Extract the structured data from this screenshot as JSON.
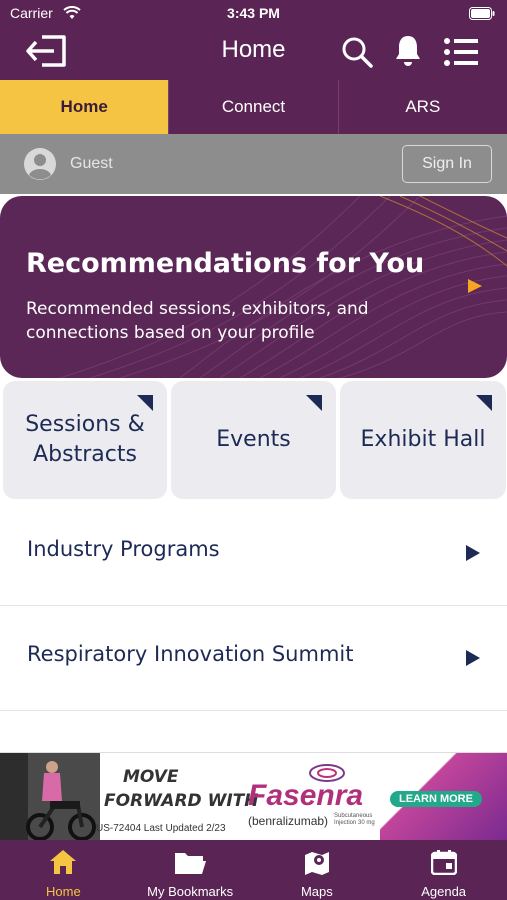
{
  "status": {
    "carrier": "Carrier",
    "time": "3:43 PM"
  },
  "header": {
    "title": "Home",
    "icons": [
      "logout-icon",
      "search-icon",
      "bell-icon",
      "menu-list-icon"
    ]
  },
  "tabs": [
    {
      "label": "Home",
      "active": true
    },
    {
      "label": "Connect",
      "active": false
    },
    {
      "label": "ARS",
      "active": false
    }
  ],
  "user": {
    "name": "Guest",
    "sign_in_label": "Sign In"
  },
  "recommendations": {
    "title": "Recommendations for You",
    "description": "Recommended sessions, exhibitors, and connections based on your profile"
  },
  "tiles": [
    {
      "label": "Sessions & Abstracts"
    },
    {
      "label": "Events"
    },
    {
      "label": "Exhibit Hall"
    }
  ],
  "list": [
    {
      "label": "Industry Programs"
    },
    {
      "label": "Respiratory Innovation Summit"
    }
  ],
  "ad": {
    "headline_1": "MOVE",
    "headline_2": "FORWARD WITH",
    "brand": "Fasenra",
    "generic": "(benralizumab)",
    "dose_1": "Subcutaneous",
    "dose_2": "Injection 30 mg",
    "cta": "LEARN MORE",
    "code": "US-72404  Last Updated 2/23"
  },
  "bottom_nav": [
    {
      "label": "Home",
      "icon": "home-icon",
      "active": true
    },
    {
      "label": "My Bookmarks",
      "icon": "folder-icon",
      "active": false
    },
    {
      "label": "Maps",
      "icon": "map-icon",
      "active": false
    },
    {
      "label": "Agenda",
      "icon": "calendar-icon",
      "active": false
    }
  ],
  "colors": {
    "brand_purple": "#5a2454",
    "accent_yellow": "#f6c443",
    "navy_text": "#1d2a55",
    "guest_bar": "#8d8d8d"
  }
}
